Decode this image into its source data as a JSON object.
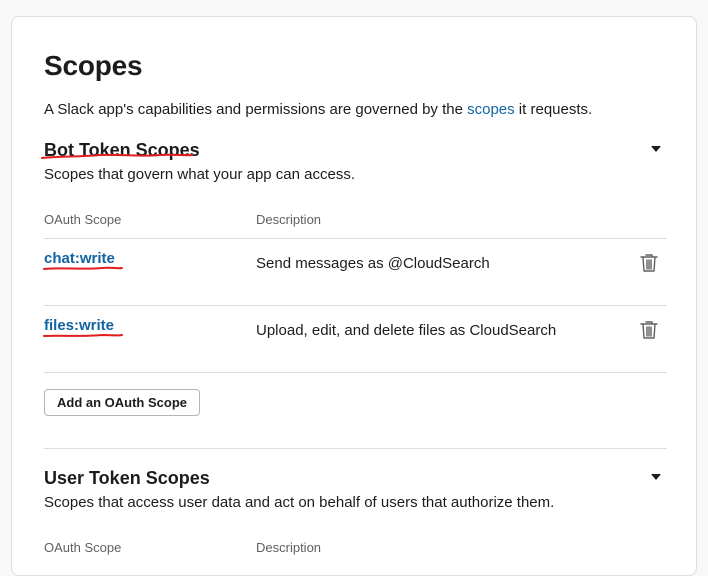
{
  "page": {
    "title": "Scopes",
    "intro_before": "A Slack app's capabilities and permissions are governed by the ",
    "intro_link": "scopes",
    "intro_after": " it requests."
  },
  "bot_section": {
    "title": "Bot Token Scopes",
    "subtitle": "Scopes that govern what your app can access.",
    "col_scope": "OAuth Scope",
    "col_desc": "Description",
    "rows": [
      {
        "scope": "chat:write",
        "description": "Send messages as @CloudSearch"
      },
      {
        "scope": "files:write",
        "description": "Upload, edit, and delete files as CloudSearch"
      }
    ],
    "add_button": "Add an OAuth Scope"
  },
  "user_section": {
    "title": "User Token Scopes",
    "subtitle": "Scopes that access user data and act on behalf of users that authorize them.",
    "col_scope": "OAuth Scope",
    "col_desc": "Description"
  },
  "colors": {
    "link": "#1264a3",
    "annotation": "#e01e1e",
    "divider": "#dddddd"
  },
  "icons": {
    "collapse": "caret-down-icon",
    "remove": "trash-icon"
  }
}
